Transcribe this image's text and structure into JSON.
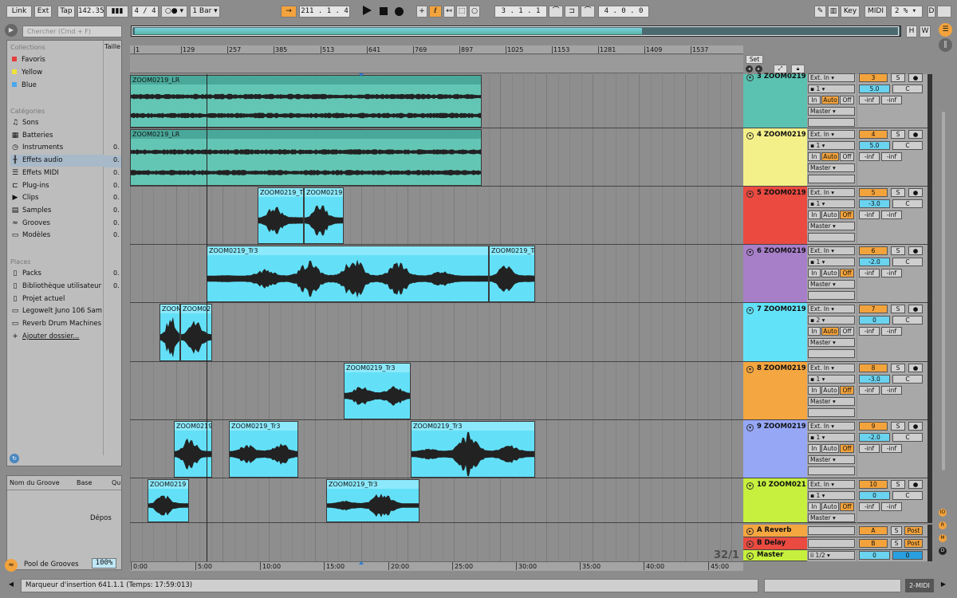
{
  "transport": {
    "link": "Link",
    "ext": "Ext",
    "tap": "Tap",
    "tempo": "142.35",
    "sig": "4 / 4",
    "metro": "○●",
    "quant": "1 Bar",
    "position": "211 . 1 . 4",
    "loop_start": "3 . 1 . 1",
    "loop_length": "4 . 0 . 0",
    "key": "Key",
    "midi": "MIDI",
    "cpu": "2 %"
  },
  "browser": {
    "search_placeholder": "Chercher (Cmd + F)",
    "size_col": "Taille",
    "collections_header": "Collections",
    "collections": [
      {
        "label": "Favoris",
        "color": "#e63c3c"
      },
      {
        "label": "Yellow",
        "color": "#f2e03a"
      },
      {
        "label": "Blue",
        "color": "#4aa8ec"
      }
    ],
    "categories_header": "Catégories",
    "categories": [
      {
        "label": "Sons",
        "icon": "♫",
        "value": ""
      },
      {
        "label": "Batteries",
        "icon": "▦",
        "value": ""
      },
      {
        "label": "Instruments",
        "icon": "◷",
        "value": "0."
      },
      {
        "label": "Effets audio",
        "icon": "╫",
        "value": "0."
      },
      {
        "label": "Effets MIDI",
        "icon": "☰",
        "value": "0."
      },
      {
        "label": "Plug-ins",
        "icon": "⊏",
        "value": "0."
      },
      {
        "label": "Clips",
        "icon": "▶",
        "value": "0."
      },
      {
        "label": "Samples",
        "icon": "▤",
        "value": "0."
      },
      {
        "label": "Grooves",
        "icon": "≈",
        "value": "0."
      },
      {
        "label": "Modèles",
        "icon": "▭",
        "value": "0."
      }
    ],
    "places_header": "Places",
    "places": [
      {
        "label": "Packs",
        "icon": "▯",
        "value": "0."
      },
      {
        "label": "Bibliothèque utilisateur",
        "icon": "▯",
        "value": "0."
      },
      {
        "label": "Projet actuel",
        "icon": "▯",
        "value": ""
      },
      {
        "label": "Legowelt Juno 106 Sam",
        "icon": "▭",
        "value": ""
      },
      {
        "label": "Reverb Drum Machines",
        "icon": "▭",
        "value": ""
      },
      {
        "label": "Ajouter dossier...",
        "icon": "+",
        "value": ""
      }
    ]
  },
  "groove": {
    "col_name": "Nom du Groove",
    "col_base": "Base",
    "col_qu": "Qu",
    "drop": "Dépos",
    "pool": "Pool de Grooves",
    "pool_value": "100%"
  },
  "ruler": {
    "bars": [
      "1",
      "129",
      "257",
      "385",
      "513",
      "641",
      "769",
      "897",
      "1025",
      "1153",
      "1281",
      "1409",
      "1537"
    ],
    "times": [
      "0:00",
      "5:00",
      "10:00",
      "15:00",
      "20:00",
      "25:00",
      "30:00",
      "35:00",
      "40:00",
      "45:00"
    ],
    "zoom": "32/1",
    "set": "Set"
  },
  "tracks": [
    {
      "label": "3 ZOOM0219",
      "color": "#5bc1b1",
      "num": "3",
      "input": "Ext. In",
      "channel": "1",
      "vol": "5.0",
      "pan": "C",
      "send_a": "-inf",
      "send_b": "-inf",
      "out": "Master",
      "monitor": "auto",
      "clips": [
        {
          "name": "ZOOM0219_LR",
          "start": 0,
          "end": 441
        }
      ]
    },
    {
      "label": "4 ZOOM0219",
      "color": "#f4f089",
      "num": "4",
      "input": "Ext. In",
      "channel": "1",
      "vol": "5.0",
      "pan": "C",
      "send_a": "-inf",
      "send_b": "-inf",
      "out": "Master",
      "monitor": "auto",
      "clips": [
        {
          "name": "ZOOM0219_LR",
          "start": 0,
          "end": 441
        }
      ]
    },
    {
      "label": "5 ZOOM0219",
      "color": "#ea4a40",
      "num": "5",
      "input": "Ext. In",
      "channel": "1",
      "vol": "-3.0",
      "pan": "C",
      "send_a": "-inf",
      "send_b": "-inf",
      "out": "Master",
      "monitor": "off",
      "clips": [
        {
          "name": "ZOOM0219_T",
          "start": 160,
          "end": 218
        },
        {
          "name": "ZOOM0219",
          "start": 218,
          "end": 268
        }
      ]
    },
    {
      "label": "6 ZOOM0219",
      "color": "#a77fc9",
      "num": "6",
      "input": "Ext. In",
      "channel": "1",
      "vol": "-2.0",
      "pan": "C",
      "send_a": "-inf",
      "send_b": "-inf",
      "out": "Master",
      "monitor": "off",
      "clips": [
        {
          "name": "ZOOM0219_Tr3",
          "start": 96,
          "end": 450
        },
        {
          "name": "ZOOM0219_Tr",
          "start": 450,
          "end": 508
        }
      ]
    },
    {
      "label": "7 ZOOM0219",
      "color": "#62e2f8",
      "num": "7",
      "input": "Ext. In",
      "channel": "2",
      "vol": "0",
      "pan": "C",
      "send_a": "-inf",
      "send_b": "-inf",
      "out": "Master",
      "monitor": "auto",
      "clips": [
        {
          "name": "ZOOM",
          "start": 37,
          "end": 63
        },
        {
          "name": "ZOOM02",
          "start": 63,
          "end": 103
        }
      ]
    },
    {
      "label": "8 ZOOM0219",
      "color": "#f4a640",
      "num": "8",
      "input": "Ext. In",
      "channel": "1",
      "vol": "-3.0",
      "pan": "C",
      "send_a": "-inf",
      "send_b": "-inf",
      "out": "Master",
      "monitor": "off",
      "clips": [
        {
          "name": "ZOOM0219_Tr3",
          "start": 268,
          "end": 352
        }
      ]
    },
    {
      "label": "9 ZOOM0219",
      "color": "#96a7f6",
      "num": "9",
      "input": "Ext. In",
      "channel": "1",
      "vol": "-2.0",
      "pan": "C",
      "send_a": "-inf",
      "send_b": "-inf",
      "out": "Master",
      "monitor": "off",
      "clips": [
        {
          "name": "ZOOM0219",
          "start": 55,
          "end": 103
        },
        {
          "name": "ZOOM0219_Tr3",
          "start": 124,
          "end": 211
        },
        {
          "name": "ZOOM0219_Tr3",
          "start": 352,
          "end": 508
        }
      ]
    },
    {
      "label": "10 ZOOM021",
      "color": "#c6f03d",
      "num": "10",
      "input": "Ext. In",
      "channel": "1",
      "vol": "0",
      "pan": "C",
      "send_a": "-inf",
      "send_b": "-inf",
      "out": "Master",
      "monitor": "off",
      "clips": [
        {
          "name": "ZOOM0219",
          "start": 22,
          "end": 74
        },
        {
          "name": "ZOOM0219_Tr3",
          "start": 246,
          "end": 363
        }
      ]
    }
  ],
  "returns": [
    {
      "label": "A Reverb",
      "color": "#f4a640",
      "letter": "A",
      "post": "Post"
    },
    {
      "label": "B Delay",
      "color": "#ea4a40",
      "letter": "B",
      "post": "Post"
    }
  ],
  "master": {
    "label": "Master",
    "color": "#c6f03d",
    "cue": "1/2",
    "vol": "0",
    "pan": "0"
  },
  "labels": {
    "in": "In",
    "auto": "Auto",
    "off": "Off",
    "s": "S",
    "h": "H",
    "w": "W"
  },
  "status": {
    "text": "Marqueur d'insertion 641.1.1 (Temps: 17:59:013)",
    "midi": "2-MIDI"
  }
}
